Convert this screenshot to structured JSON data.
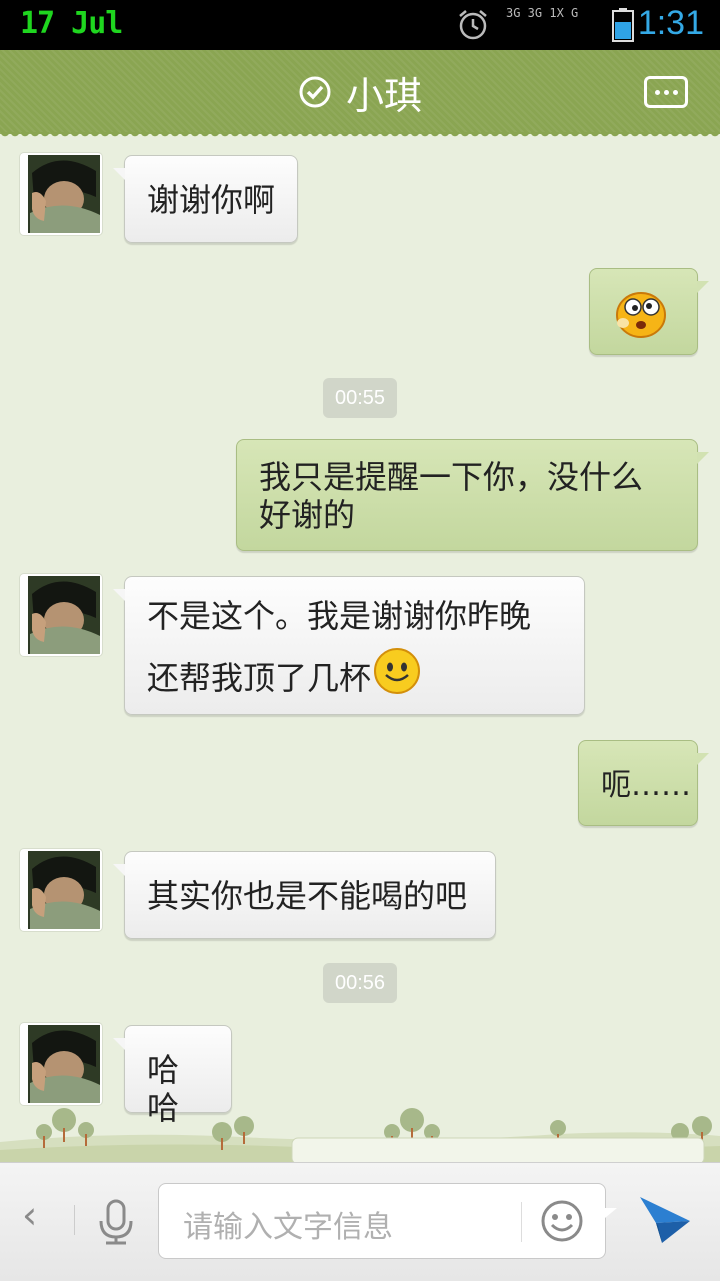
{
  "status_bar": {
    "date": "17 Jul",
    "time": "1:31",
    "network": "3G 3G 1X G",
    "icons": [
      "alarm-icon",
      "signal-icon",
      "battery-icon"
    ]
  },
  "title_bar": {
    "title": "小琪",
    "verified_icon": "check-circle-icon",
    "menu_icon": "chat-menu-icon"
  },
  "messages": [
    {
      "side": "in",
      "text": "谢谢你啊"
    },
    {
      "side": "out",
      "emoji": "dizzy-face-emoji"
    },
    {
      "timestamp": "00:55"
    },
    {
      "side": "out",
      "line1": "我只是提醒一下你，没什么",
      "line2": "好谢的"
    },
    {
      "side": "in",
      "line1": "不是这个。我是谢谢你昨晚",
      "line2": "还帮我顶了几杯",
      "emoji": "smile-emoji"
    },
    {
      "side": "out",
      "text": "呃……"
    },
    {
      "side": "in",
      "text": "其实你也是不能喝的吧"
    },
    {
      "timestamp": "00:56"
    },
    {
      "side": "in",
      "text": "哈哈"
    }
  ],
  "input_bar": {
    "placeholder": "请输入文字信息",
    "back_icon": "chevron-left-icon",
    "mic_icon": "microphone-icon",
    "emoji_icon": "smiley-icon",
    "send_icon": "send-icon"
  },
  "colors": {
    "title_bar": "#8aa552",
    "background": "#e9efde",
    "incoming_bubble": "#f6f6f6",
    "outgoing_bubble": "#cddfa9",
    "date": "#1fd61f",
    "time": "#34a9e6"
  }
}
